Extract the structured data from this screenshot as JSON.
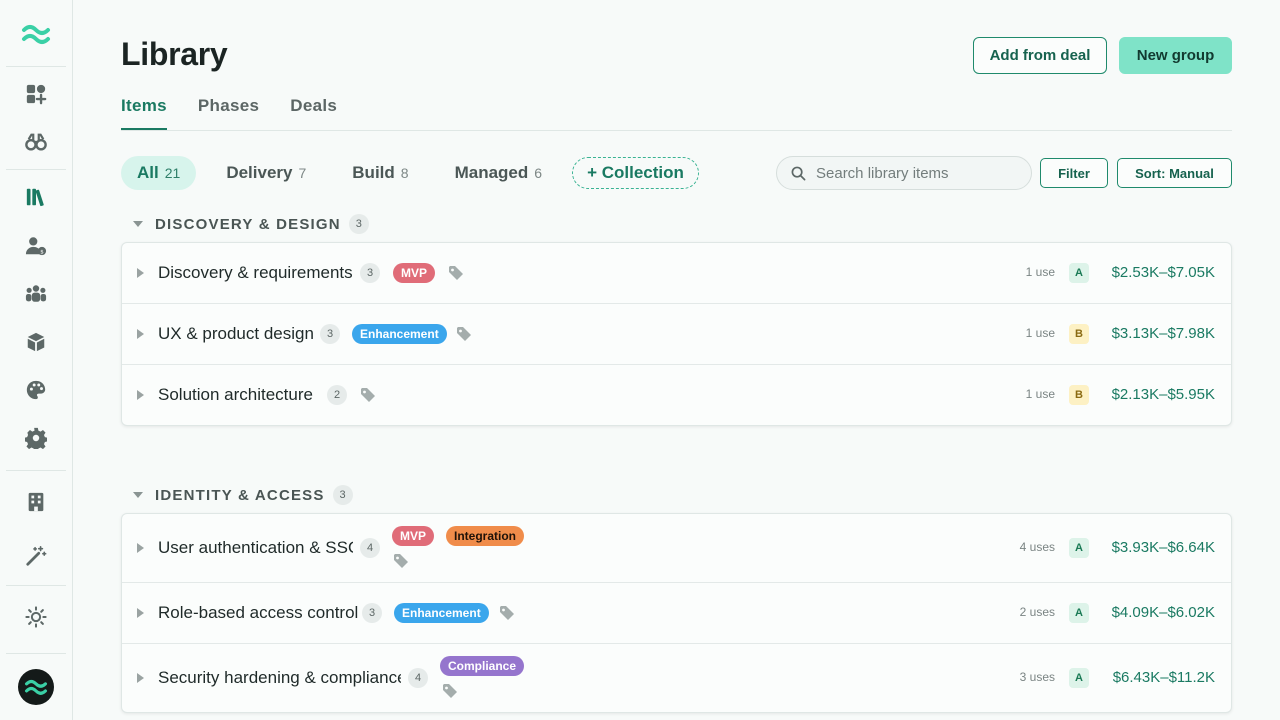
{
  "sidebar": {
    "logo": "wave-logo-icon",
    "icons": [
      {
        "name": "dashboard-add-icon"
      },
      {
        "name": "binoculars-icon"
      },
      {
        "name": "library-books-icon"
      },
      {
        "name": "user-billing-icon"
      },
      {
        "name": "team-icon"
      },
      {
        "name": "package-box-icon"
      },
      {
        "name": "palette-icon"
      },
      {
        "name": "settings-gear-icon"
      },
      {
        "name": "building-icon"
      },
      {
        "name": "magic-wand-icon"
      },
      {
        "name": "sun-theme-icon"
      }
    ],
    "avatar": "user-avatar"
  },
  "header": {
    "title": "Library",
    "add_from_deal": "Add from deal",
    "new_group": "New group"
  },
  "tabs": [
    {
      "label": "Items",
      "active": true
    },
    {
      "label": "Phases",
      "active": false
    },
    {
      "label": "Deals",
      "active": false
    }
  ],
  "filters": {
    "pills": [
      {
        "label": "All",
        "count": "21",
        "active": true
      },
      {
        "label": "Delivery",
        "count": "7",
        "active": false
      },
      {
        "label": "Build",
        "count": "8",
        "active": false
      },
      {
        "label": "Managed",
        "count": "6",
        "active": false
      }
    ],
    "collection": "+ Collection",
    "search_placeholder": "Search library items",
    "filter": "Filter",
    "sort": "Sort: Manual"
  },
  "groups": [
    {
      "title": "DISCOVERY & DESIGN",
      "count": "3",
      "rows": [
        {
          "name": "Discovery & requirements",
          "count": "3",
          "tags": [
            "MVP"
          ],
          "uses": "1 use",
          "grade": "A",
          "price": "$2.53K–$7.05K"
        },
        {
          "name": "UX & product design",
          "count": "3",
          "tags": [
            "Enhancement"
          ],
          "uses": "1 use",
          "grade": "B",
          "price": "$3.13K–$7.98K"
        },
        {
          "name": "Solution architecture",
          "count": "2",
          "tags": [],
          "uses": "1 use",
          "grade": "B",
          "price": "$2.13K–$5.95K"
        }
      ]
    },
    {
      "title": "IDENTITY & ACCESS",
      "count": "3",
      "rows": [
        {
          "name": "User authentication & SSO",
          "count": "4",
          "tags": [
            "MVP",
            "Integration"
          ],
          "uses": "4 uses",
          "grade": "A",
          "price": "$3.93K–$6.64K"
        },
        {
          "name": "Role-based access control",
          "count": "3",
          "tags": [
            "Enhancement"
          ],
          "uses": "2 uses",
          "grade": "A",
          "price": "$4.09K–$6.02K"
        },
        {
          "name": "Security hardening & compliance",
          "count": "4",
          "tags": [
            "Compliance"
          ],
          "uses": "3 uses",
          "grade": "A",
          "price": "$6.43K–$11.2K"
        }
      ]
    }
  ],
  "colors": {
    "accent": "#1a7a62",
    "primary_button": "#7fe3c8",
    "tag_mvp": "#e06c78",
    "tag_enhancement": "#3aa6ec",
    "tag_integration": "#f08c4a",
    "tag_compliance": "#9575cd"
  }
}
